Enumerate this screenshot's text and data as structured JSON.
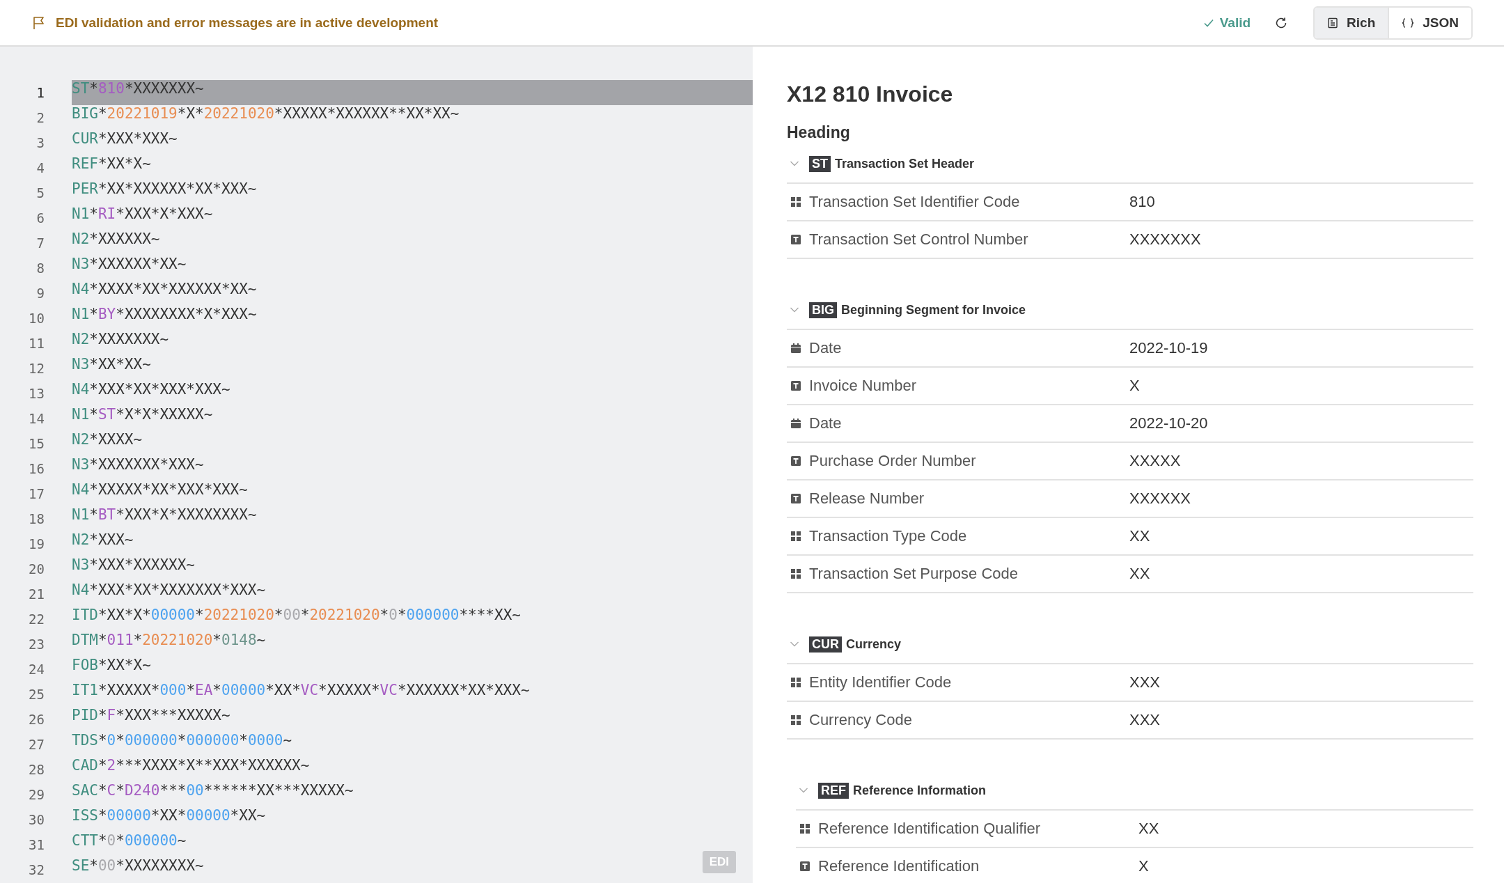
{
  "banner": {
    "text": "EDI validation and error messages are in active development"
  },
  "toolbar": {
    "status": "Valid",
    "views": [
      {
        "label": "Rich",
        "selected": true
      },
      {
        "label": "JSON",
        "selected": false
      }
    ]
  },
  "editor": {
    "badge": "EDI",
    "lines": [
      {
        "number": "1",
        "selected": true,
        "tokens": [
          {
            "kind": "seg",
            "text": "ST"
          },
          {
            "kind": "plain",
            "text": "*"
          },
          {
            "kind": "qual",
            "text": "810"
          },
          {
            "kind": "plain",
            "text": "*XXXXXXX~"
          }
        ]
      },
      {
        "number": "2",
        "selected": false,
        "tokens": [
          {
            "kind": "seg",
            "text": "BIG"
          },
          {
            "kind": "plain",
            "text": "*"
          },
          {
            "kind": "date",
            "text": "20221019"
          },
          {
            "kind": "plain",
            "text": "*X*"
          },
          {
            "kind": "date",
            "text": "20221020"
          },
          {
            "kind": "plain",
            "text": "*XXXXX*XXXXXX**XX*XX~"
          }
        ]
      },
      {
        "number": "3",
        "selected": false,
        "tokens": [
          {
            "kind": "seg",
            "text": "CUR"
          },
          {
            "kind": "plain",
            "text": "*XXX*XXX~"
          }
        ]
      },
      {
        "number": "4",
        "selected": false,
        "tokens": [
          {
            "kind": "seg",
            "text": "REF"
          },
          {
            "kind": "plain",
            "text": "*XX*X~"
          }
        ]
      },
      {
        "number": "5",
        "selected": false,
        "tokens": [
          {
            "kind": "seg",
            "text": "PER"
          },
          {
            "kind": "plain",
            "text": "*XX*XXXXXX*XX*XXX~"
          }
        ]
      },
      {
        "number": "6",
        "selected": false,
        "tokens": [
          {
            "kind": "seg",
            "text": "N1"
          },
          {
            "kind": "plain",
            "text": "*"
          },
          {
            "kind": "qual",
            "text": "RI"
          },
          {
            "kind": "plain",
            "text": "*XXX*X*XXX~"
          }
        ]
      },
      {
        "number": "7",
        "selected": false,
        "tokens": [
          {
            "kind": "seg",
            "text": "N2"
          },
          {
            "kind": "plain",
            "text": "*XXXXXX~"
          }
        ]
      },
      {
        "number": "8",
        "selected": false,
        "tokens": [
          {
            "kind": "seg",
            "text": "N3"
          },
          {
            "kind": "plain",
            "text": "*XXXXXX*XX~"
          }
        ]
      },
      {
        "number": "9",
        "selected": false,
        "tokens": [
          {
            "kind": "seg",
            "text": "N4"
          },
          {
            "kind": "plain",
            "text": "*XXXX*XX*XXXXXX*XX~"
          }
        ]
      },
      {
        "number": "10",
        "selected": false,
        "tokens": [
          {
            "kind": "seg",
            "text": "N1"
          },
          {
            "kind": "plain",
            "text": "*"
          },
          {
            "kind": "qual",
            "text": "BY"
          },
          {
            "kind": "plain",
            "text": "*XXXXXXXX*X*XXX~"
          }
        ]
      },
      {
        "number": "11",
        "selected": false,
        "tokens": [
          {
            "kind": "seg",
            "text": "N2"
          },
          {
            "kind": "plain",
            "text": "*XXXXXXX~"
          }
        ]
      },
      {
        "number": "12",
        "selected": false,
        "tokens": [
          {
            "kind": "seg",
            "text": "N3"
          },
          {
            "kind": "plain",
            "text": "*XX*XX~"
          }
        ]
      },
      {
        "number": "13",
        "selected": false,
        "tokens": [
          {
            "kind": "seg",
            "text": "N4"
          },
          {
            "kind": "plain",
            "text": "*XXX*XX*XXX*XXX~"
          }
        ]
      },
      {
        "number": "14",
        "selected": false,
        "tokens": [
          {
            "kind": "seg",
            "text": "N1"
          },
          {
            "kind": "plain",
            "text": "*"
          },
          {
            "kind": "qual",
            "text": "ST"
          },
          {
            "kind": "plain",
            "text": "*X*X*XXXXX~"
          }
        ]
      },
      {
        "number": "15",
        "selected": false,
        "tokens": [
          {
            "kind": "seg",
            "text": "N2"
          },
          {
            "kind": "plain",
            "text": "*XXXX~"
          }
        ]
      },
      {
        "number": "16",
        "selected": false,
        "tokens": [
          {
            "kind": "seg",
            "text": "N3"
          },
          {
            "kind": "plain",
            "text": "*XXXXXXX*XXX~"
          }
        ]
      },
      {
        "number": "17",
        "selected": false,
        "tokens": [
          {
            "kind": "seg",
            "text": "N4"
          },
          {
            "kind": "plain",
            "text": "*XXXXX*XX*XXX*XXX~"
          }
        ]
      },
      {
        "number": "18",
        "selected": false,
        "tokens": [
          {
            "kind": "seg",
            "text": "N1"
          },
          {
            "kind": "plain",
            "text": "*"
          },
          {
            "kind": "qual",
            "text": "BT"
          },
          {
            "kind": "plain",
            "text": "*XXX*X*XXXXXXXX~"
          }
        ]
      },
      {
        "number": "19",
        "selected": false,
        "tokens": [
          {
            "kind": "seg",
            "text": "N2"
          },
          {
            "kind": "plain",
            "text": "*XXX~"
          }
        ]
      },
      {
        "number": "20",
        "selected": false,
        "tokens": [
          {
            "kind": "seg",
            "text": "N3"
          },
          {
            "kind": "plain",
            "text": "*XXX*XXXXXX~"
          }
        ]
      },
      {
        "number": "21",
        "selected": false,
        "tokens": [
          {
            "kind": "seg",
            "text": "N4"
          },
          {
            "kind": "plain",
            "text": "*XXX*XX*XXXXXXX*XXX~"
          }
        ]
      },
      {
        "number": "22",
        "selected": false,
        "tokens": [
          {
            "kind": "seg",
            "text": "ITD"
          },
          {
            "kind": "plain",
            "text": "*XX*X*"
          },
          {
            "kind": "num",
            "text": "00000"
          },
          {
            "kind": "plain",
            "text": "*"
          },
          {
            "kind": "date",
            "text": "20221020"
          },
          {
            "kind": "plain",
            "text": "*"
          },
          {
            "kind": "empty",
            "text": "00"
          },
          {
            "kind": "plain",
            "text": "*"
          },
          {
            "kind": "date",
            "text": "20221020"
          },
          {
            "kind": "plain",
            "text": "*"
          },
          {
            "kind": "empty",
            "text": "0"
          },
          {
            "kind": "plain",
            "text": "*"
          },
          {
            "kind": "num",
            "text": "000000"
          },
          {
            "kind": "plain",
            "text": "****XX~"
          }
        ]
      },
      {
        "number": "23",
        "selected": false,
        "tokens": [
          {
            "kind": "seg",
            "text": "DTM"
          },
          {
            "kind": "plain",
            "text": "*"
          },
          {
            "kind": "qual",
            "text": "011"
          },
          {
            "kind": "plain",
            "text": "*"
          },
          {
            "kind": "date",
            "text": "20221020"
          },
          {
            "kind": "plain",
            "text": "*"
          },
          {
            "kind": "time",
            "text": "0148"
          },
          {
            "kind": "plain",
            "text": "~"
          }
        ]
      },
      {
        "number": "24",
        "selected": false,
        "tokens": [
          {
            "kind": "seg",
            "text": "FOB"
          },
          {
            "kind": "plain",
            "text": "*XX*X~"
          }
        ]
      },
      {
        "number": "25",
        "selected": false,
        "tokens": [
          {
            "kind": "seg",
            "text": "IT1"
          },
          {
            "kind": "plain",
            "text": "*XXXXX*"
          },
          {
            "kind": "num",
            "text": "000"
          },
          {
            "kind": "plain",
            "text": "*"
          },
          {
            "kind": "qual",
            "text": "EA"
          },
          {
            "kind": "plain",
            "text": "*"
          },
          {
            "kind": "num",
            "text": "00000"
          },
          {
            "kind": "plain",
            "text": "*XX*"
          },
          {
            "kind": "qual",
            "text": "VC"
          },
          {
            "kind": "plain",
            "text": "*XXXXX*"
          },
          {
            "kind": "qual",
            "text": "VC"
          },
          {
            "kind": "plain",
            "text": "*XXXXXX*XX*XXX~"
          }
        ]
      },
      {
        "number": "26",
        "selected": false,
        "tokens": [
          {
            "kind": "seg",
            "text": "PID"
          },
          {
            "kind": "plain",
            "text": "*"
          },
          {
            "kind": "qual",
            "text": "F"
          },
          {
            "kind": "plain",
            "text": "*XXX***XXXXX~"
          }
        ]
      },
      {
        "number": "27",
        "selected": false,
        "tokens": [
          {
            "kind": "seg",
            "text": "TDS"
          },
          {
            "kind": "plain",
            "text": "*"
          },
          {
            "kind": "num",
            "text": "0"
          },
          {
            "kind": "plain",
            "text": "*"
          },
          {
            "kind": "num",
            "text": "000000"
          },
          {
            "kind": "plain",
            "text": "*"
          },
          {
            "kind": "num",
            "text": "000000"
          },
          {
            "kind": "plain",
            "text": "*"
          },
          {
            "kind": "num",
            "text": "0000"
          },
          {
            "kind": "plain",
            "text": "~"
          }
        ]
      },
      {
        "number": "28",
        "selected": false,
        "tokens": [
          {
            "kind": "seg",
            "text": "CAD"
          },
          {
            "kind": "plain",
            "text": "*"
          },
          {
            "kind": "qual",
            "text": "2"
          },
          {
            "kind": "plain",
            "text": "***XXXX*X**XXX*XXXXXX~"
          }
        ]
      },
      {
        "number": "29",
        "selected": false,
        "tokens": [
          {
            "kind": "seg",
            "text": "SAC"
          },
          {
            "kind": "plain",
            "text": "*"
          },
          {
            "kind": "qual",
            "text": "C"
          },
          {
            "kind": "plain",
            "text": "*"
          },
          {
            "kind": "qual",
            "text": "D240"
          },
          {
            "kind": "plain",
            "text": "***"
          },
          {
            "kind": "num",
            "text": "00"
          },
          {
            "kind": "plain",
            "text": "******XX***XXXXX~"
          }
        ]
      },
      {
        "number": "30",
        "selected": false,
        "tokens": [
          {
            "kind": "seg",
            "text": "ISS"
          },
          {
            "kind": "plain",
            "text": "*"
          },
          {
            "kind": "num",
            "text": "00000"
          },
          {
            "kind": "plain",
            "text": "*XX*"
          },
          {
            "kind": "num",
            "text": "00000"
          },
          {
            "kind": "plain",
            "text": "*XX~"
          }
        ]
      },
      {
        "number": "31",
        "selected": false,
        "tokens": [
          {
            "kind": "seg",
            "text": "CTT"
          },
          {
            "kind": "plain",
            "text": "*"
          },
          {
            "kind": "empty",
            "text": "0"
          },
          {
            "kind": "plain",
            "text": "*"
          },
          {
            "kind": "num",
            "text": "000000"
          },
          {
            "kind": "plain",
            "text": "~"
          }
        ]
      },
      {
        "number": "32",
        "selected": false,
        "tokens": [
          {
            "kind": "seg",
            "text": "SE"
          },
          {
            "kind": "plain",
            "text": "*"
          },
          {
            "kind": "empty",
            "text": "00"
          },
          {
            "kind": "plain",
            "text": "*XXXXXXXX~"
          }
        ]
      }
    ]
  },
  "document": {
    "title": "X12 810 Invoice",
    "heading": "Heading",
    "sections": [
      {
        "kind": "segment",
        "code": "ST",
        "name": "Transaction Set Header",
        "expanded": true,
        "fields": [
          {
            "kind": "enum",
            "label": "Transaction Set Identifier Code",
            "value": "810"
          },
          {
            "kind": "text",
            "label": "Transaction Set Control Number",
            "value": "XXXXXXX"
          }
        ]
      },
      {
        "kind": "segment",
        "code": "BIG",
        "name": "Beginning Segment for Invoice",
        "expanded": true,
        "fields": [
          {
            "kind": "date",
            "label": "Date",
            "value": "2022-10-19"
          },
          {
            "kind": "text",
            "label": "Invoice Number",
            "value": "X"
          },
          {
            "kind": "date",
            "label": "Date",
            "value": "2022-10-20"
          },
          {
            "kind": "text",
            "label": "Purchase Order Number",
            "value": "XXXXX"
          },
          {
            "kind": "text",
            "label": "Release Number",
            "value": "XXXXXX"
          },
          {
            "kind": "enum",
            "label": "Transaction Type Code",
            "value": "XX"
          },
          {
            "kind": "enum",
            "label": "Transaction Set Purpose Code",
            "value": "XX"
          }
        ]
      },
      {
        "kind": "segment",
        "code": "CUR",
        "name": "Currency",
        "expanded": true,
        "fields": [
          {
            "kind": "enum",
            "label": "Entity Identifier Code",
            "value": "XXX"
          },
          {
            "kind": "enum",
            "label": "Currency Code",
            "value": "XXX"
          }
        ]
      },
      {
        "kind": "group",
        "children": [
          {
            "kind": "segment",
            "code": "REF",
            "name": "Reference Information",
            "expanded": true,
            "fields": [
              {
                "kind": "enum",
                "label": "Reference Identification Qualifier",
                "value": "XX"
              },
              {
                "kind": "text",
                "label": "Reference Identification",
                "value": "X"
              }
            ]
          }
        ]
      }
    ]
  }
}
